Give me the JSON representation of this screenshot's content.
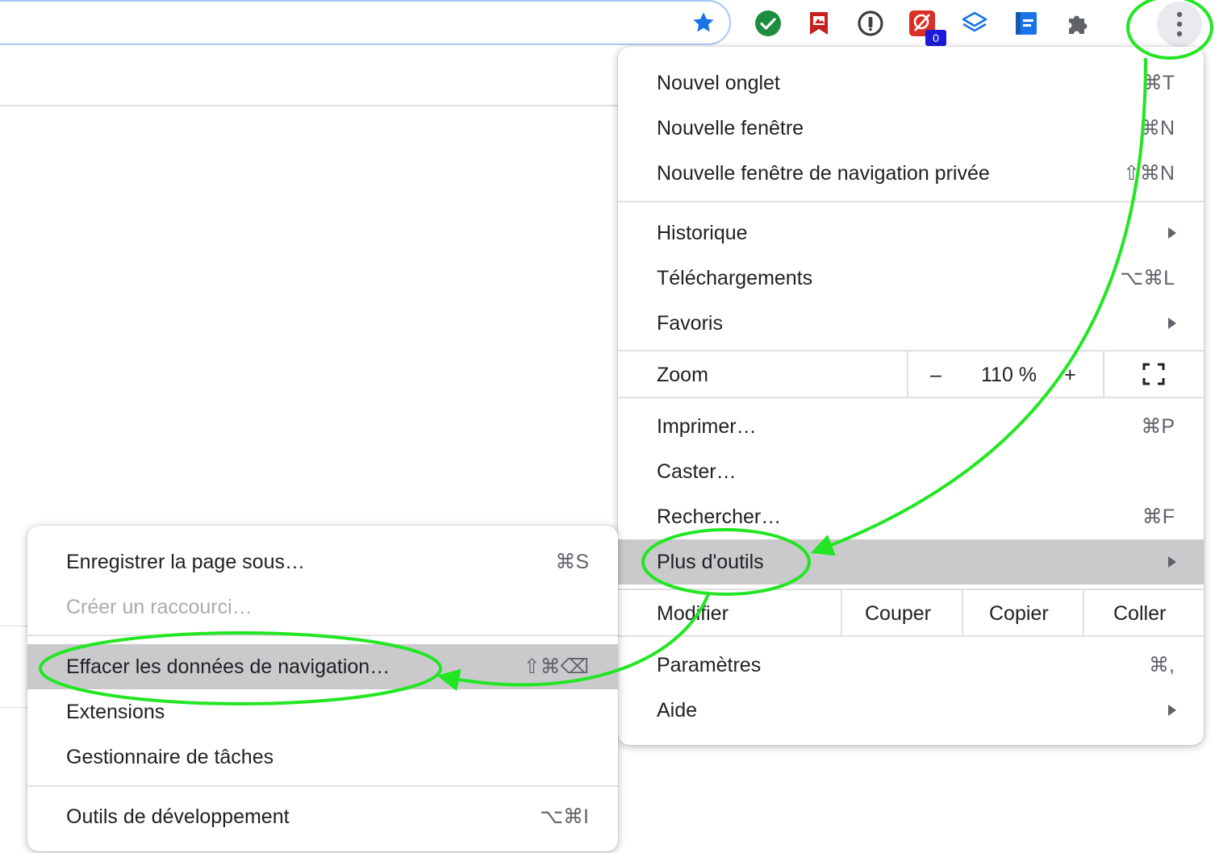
{
  "toolbar": {
    "bookmark_icon": "star-icon",
    "extensions": [
      {
        "name": "green-check-extension-icon",
        "color": "#1e8e3e"
      },
      {
        "name": "bookmark-extension-icon",
        "color": "#c5221f"
      },
      {
        "name": "password-manager-extension-icon",
        "color": "#3c4043"
      },
      {
        "name": "red-ext-extension-icon",
        "color": "#d93025"
      },
      {
        "name": "layers-extension-icon",
        "color": "#1a73e8"
      },
      {
        "name": "blue-book-extension-icon",
        "color": "#1a73e8"
      },
      {
        "name": "puzzle-extension-icon",
        "color": "#5f6368"
      }
    ],
    "badge_count": "0",
    "menu_icon": "more-vertical-icon"
  },
  "main_menu": {
    "new_tab": {
      "label": "Nouvel onglet",
      "shortcut": "⌘T"
    },
    "new_window": {
      "label": "Nouvelle fenêtre",
      "shortcut": "⌘N"
    },
    "new_incognito": {
      "label": "Nouvelle fenêtre de navigation privée",
      "shortcut": "⇧⌘N"
    },
    "history": {
      "label": "Historique"
    },
    "downloads": {
      "label": "Téléchargements",
      "shortcut": "⌥⌘L"
    },
    "bookmarks": {
      "label": "Favoris"
    },
    "zoom": {
      "label": "Zoom",
      "minus": "–",
      "value": "110 %",
      "plus": "+"
    },
    "print": {
      "label": "Imprimer…",
      "shortcut": "⌘P"
    },
    "cast": {
      "label": "Caster…"
    },
    "find": {
      "label": "Rechercher…",
      "shortcut": "⌘F"
    },
    "more_tools": {
      "label": "Plus d'outils"
    },
    "edit": {
      "label": "Modifier",
      "cut": "Couper",
      "copy": "Copier",
      "paste": "Coller"
    },
    "settings": {
      "label": "Paramètres",
      "shortcut": "⌘,"
    },
    "help": {
      "label": "Aide"
    }
  },
  "sub_menu": {
    "save_page": {
      "label": "Enregistrer la page sous…",
      "shortcut": "⌘S"
    },
    "create_shortcut": {
      "label": "Créer un raccourci…"
    },
    "clear_data": {
      "label": "Effacer les données de navigation…",
      "shortcut": "⇧⌘⌫"
    },
    "extensions": {
      "label": "Extensions"
    },
    "task_manager": {
      "label": "Gestionnaire de tâches"
    },
    "devtools": {
      "label": "Outils de développement",
      "shortcut": "⌥⌘I"
    }
  },
  "colors": {
    "annotation": "#22e622",
    "highlight": "#cacacc",
    "star": "#1a73e8"
  }
}
